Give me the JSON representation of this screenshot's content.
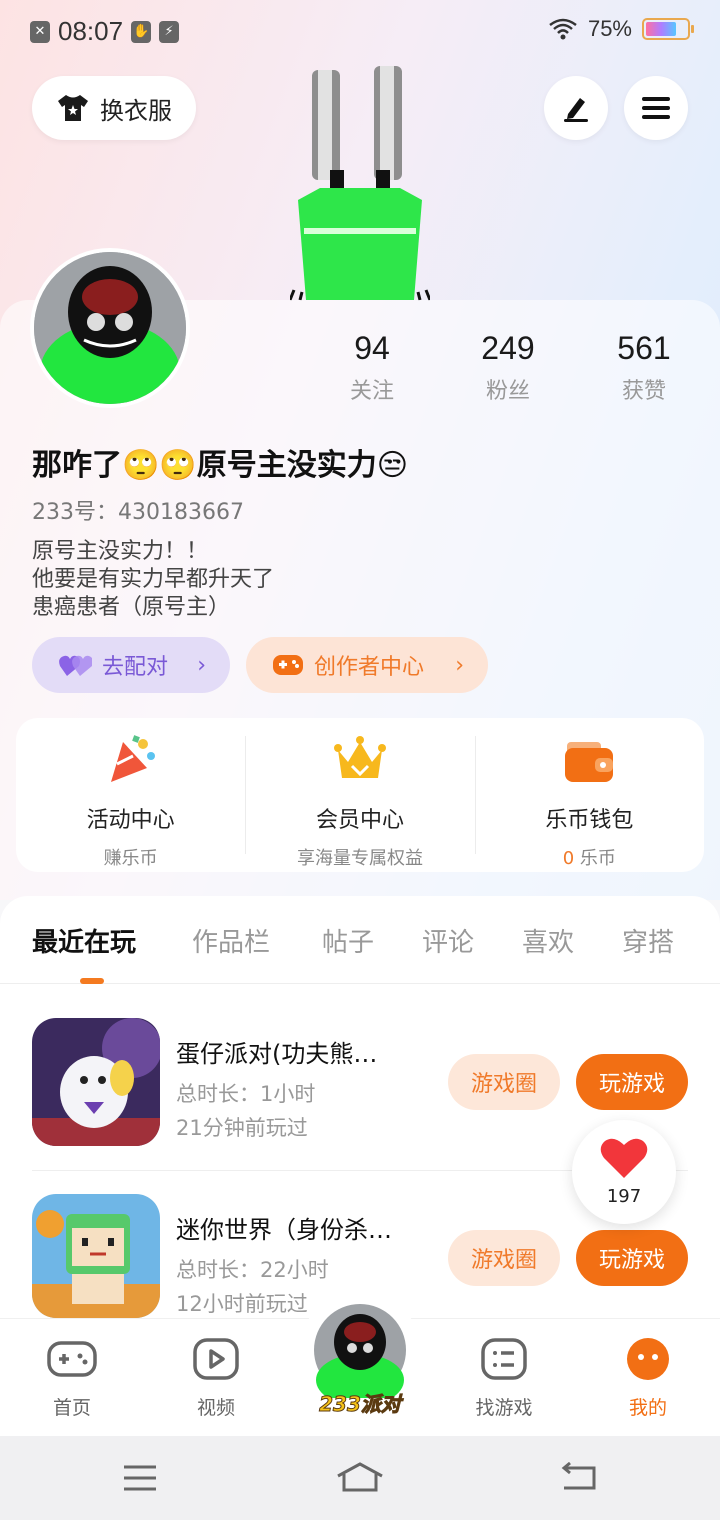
{
  "status_bar": {
    "time": "08:07",
    "battery": "75%",
    "battery_level": 0.75
  },
  "top": {
    "outfit_label": "换衣服"
  },
  "profile": {
    "stats": [
      {
        "value": "94",
        "label": "关注"
      },
      {
        "value": "249",
        "label": "粉丝"
      },
      {
        "value": "561",
        "label": "获赞"
      }
    ],
    "nickname": "那咋了🙄🙄原号主没实力😒",
    "uid": "233号：430183667",
    "bio": [
      "原号主没实力！！",
      "他要是有实力早都升天了",
      "患癌患者（原号主）"
    ],
    "match_label": "去配对",
    "creator_label": "创作者中心"
  },
  "features": [
    {
      "title": "活动中心",
      "sub": "赚乐币"
    },
    {
      "title": "会员中心",
      "sub": "享海量专属权益"
    },
    {
      "title": "乐币钱包",
      "coin_count": "0",
      "sub": "乐币"
    }
  ],
  "tabs": [
    "最近在玩",
    "作品栏",
    "帖子",
    "评论",
    "喜欢",
    "穿搭"
  ],
  "games": [
    {
      "name": "蛋仔派对(功夫熊…",
      "duration": "总时长：1小时",
      "last_played": "21分钟前玩过",
      "circle_label": "游戏圈",
      "play_label": "玩游戏"
    },
    {
      "name": "迷你世界（身份杀…",
      "duration": "总时长：22小时",
      "last_played": "12小时前玩过",
      "circle_label": "游戏圈",
      "play_label": "玩游戏"
    }
  ],
  "like_count": "197",
  "bottom_nav": [
    {
      "label": "首页"
    },
    {
      "label": "视频"
    },
    {
      "label": "233派对"
    },
    {
      "label": "找游戏"
    },
    {
      "label": "我的"
    }
  ],
  "colors": {
    "accent": "#F26F14",
    "purple": "#7A59D6"
  }
}
